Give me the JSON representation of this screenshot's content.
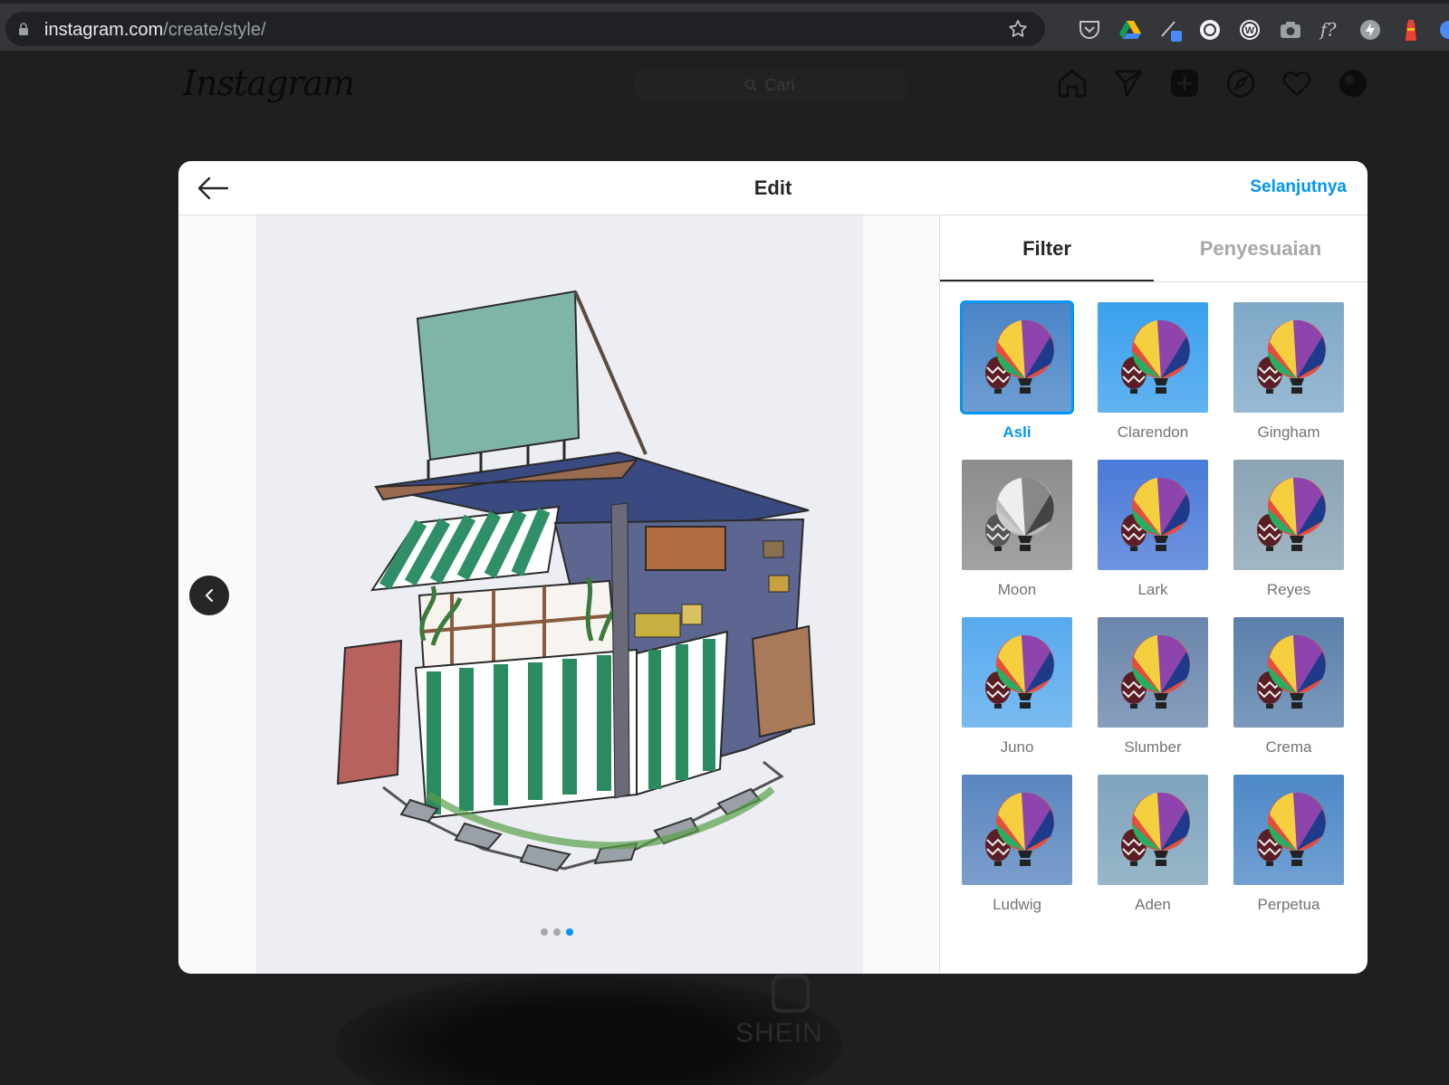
{
  "browser": {
    "url_domain": "instagram.com",
    "url_path": "/create/style/"
  },
  "ig": {
    "logo": "Instagram",
    "search_placeholder": "Cari"
  },
  "backdrop": {
    "watermark": "SHEIN"
  },
  "modal": {
    "title": "Edit",
    "next_label": "Selanjutnya",
    "tabs": [
      "Filter",
      "Penyesuaian"
    ],
    "filters": [
      {
        "name": "Asli",
        "selected": true,
        "bg": "#4a84c6"
      },
      {
        "name": "Clarendon",
        "selected": false,
        "bg": "#3aa0ee"
      },
      {
        "name": "Gingham",
        "selected": false,
        "bg": "#7fa8c8"
      },
      {
        "name": "Moon",
        "selected": false,
        "bg": "#8c8c8c"
      },
      {
        "name": "Lark",
        "selected": false,
        "bg": "#4a7ad8"
      },
      {
        "name": "Reyes",
        "selected": false,
        "bg": "#8aa4b4"
      },
      {
        "name": "Juno",
        "selected": false,
        "bg": "#58aaee"
      },
      {
        "name": "Slumber",
        "selected": false,
        "bg": "#6a86ac"
      },
      {
        "name": "Crema",
        "selected": false,
        "bg": "#5a80ac"
      },
      {
        "name": "Ludwig",
        "selected": false,
        "bg": "#5a86c0"
      },
      {
        "name": "Aden",
        "selected": false,
        "bg": "#7ea4bc"
      },
      {
        "name": "Perpetua",
        "selected": false,
        "bg": "#4d88c8"
      }
    ],
    "carousel_dots": 3,
    "carousel_active": 3
  },
  "colors": {
    "accent": "#0095f6"
  }
}
